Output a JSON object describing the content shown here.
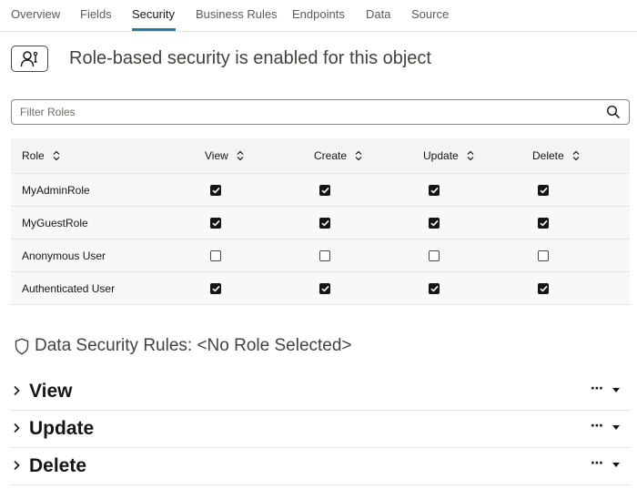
{
  "tabs": [
    {
      "label": "Overview"
    },
    {
      "label": "Fields"
    },
    {
      "label": "Security",
      "active": true
    },
    {
      "label": "Business Rules"
    },
    {
      "label": "Endpoints"
    },
    {
      "label": "Data"
    },
    {
      "label": "Source"
    }
  ],
  "header": {
    "icon": "role-security-icon",
    "title": "Role-based security is enabled for this object"
  },
  "filter": {
    "placeholder": "Filter Roles",
    "value": "",
    "icon": "search-icon"
  },
  "table": {
    "columns": [
      "Role",
      "View",
      "Create",
      "Update",
      "Delete"
    ],
    "rows": [
      {
        "role": "MyAdminRole",
        "view": true,
        "create": true,
        "update": true,
        "delete": true
      },
      {
        "role": "MyGuestRole",
        "view": true,
        "create": true,
        "update": true,
        "delete": true
      },
      {
        "role": "Anonymous User",
        "view": false,
        "create": false,
        "update": false,
        "delete": false
      },
      {
        "role": "Authenticated User",
        "view": true,
        "create": true,
        "update": true,
        "delete": true
      }
    ]
  },
  "rules": {
    "icon": "shield-icon",
    "title": "Data Security Rules: <No Role Selected>",
    "sections": [
      {
        "label": "View",
        "more": "⋯"
      },
      {
        "label": "Update",
        "more": "⋯"
      },
      {
        "label": "Delete",
        "more": "⋯"
      }
    ]
  },
  "colors": {
    "accent": "#227e9e",
    "header_bg": "#f6f4f2",
    "row_bg": "#f9f8f6",
    "border": "#e5e1dc"
  }
}
